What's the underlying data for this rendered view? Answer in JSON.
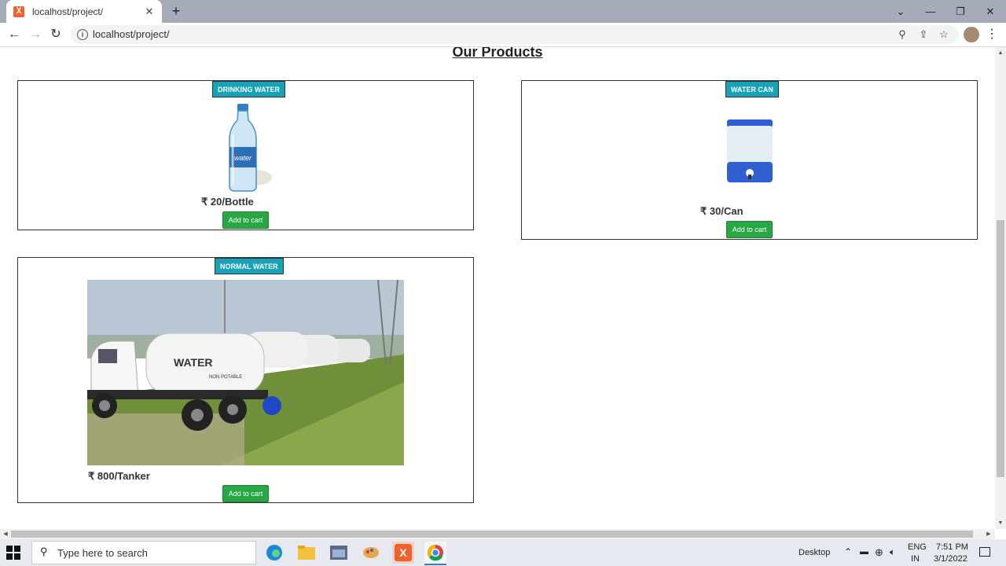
{
  "browser": {
    "tab_title": "localhost/project/",
    "url": "localhost/project/",
    "new_tab_symbol": "+",
    "close_symbol": "✕"
  },
  "page": {
    "heading": "Our Products",
    "products": [
      {
        "badge": "DRINKING WATER",
        "price": "₹ 20/Bottle",
        "button": "Add to cart",
        "image": "water-bottle-image"
      },
      {
        "badge": "WATER CAN",
        "price": "₹ 30/Can",
        "button": "Add to cart",
        "image": "water-can-image"
      },
      {
        "badge": "NORMAL WATER",
        "price": "₹ 800/Tanker",
        "button": "Add to cart",
        "image": "water-tanker-trucks-image",
        "truck_text_1": "WATER",
        "truck_text_2": "NON POTABLE"
      }
    ]
  },
  "taskbar": {
    "search_placeholder": "Type here to search",
    "desktop_label": "Desktop",
    "lang_line1": "ENG",
    "lang_line2": "IN",
    "time": "7:51 PM",
    "date": "3/1/2022"
  },
  "colors": {
    "badge": "#17a2b8",
    "button": "#28a745",
    "tab_strip": "#a5abb8"
  }
}
